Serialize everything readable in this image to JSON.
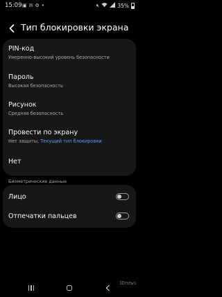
{
  "status": {
    "time": "15:09",
    "battery": "35%",
    "left_icons": [
      "image-icon",
      "mail-icon",
      "settings-icon",
      "dot-icon"
    ],
    "right_icons": [
      "mute-icon",
      "wifi-icon",
      "signal-icon"
    ]
  },
  "header": {
    "title": "Тип блокировки экрана"
  },
  "lock_types": [
    {
      "title": "PIN-код",
      "subtitle": "Умеренно-высокий уровень безопасности"
    },
    {
      "title": "Пароль",
      "subtitle": "Высокая безопасность"
    },
    {
      "title": "Рисунок",
      "subtitle": "Средняя безопасность"
    },
    {
      "title": "Провести по экрану",
      "subtitle": "Нет защиты,",
      "subtitle_link": "Текущий тип блокировки"
    },
    {
      "title": "Нет"
    }
  ],
  "biometrics": {
    "section_label": "Биометрические данные",
    "items": [
      {
        "label": "Лицо",
        "enabled": false
      },
      {
        "label": "Отпечатки пальцев",
        "enabled": false
      }
    ]
  },
  "navigation": {
    "buttons": [
      "recent-apps",
      "home",
      "back"
    ]
  },
  "watermark": "3Dnews",
  "colors": {
    "background": "#000000",
    "card": "#171717",
    "link": "#5a9ef5",
    "secondary_text": "#a8a8a8"
  }
}
